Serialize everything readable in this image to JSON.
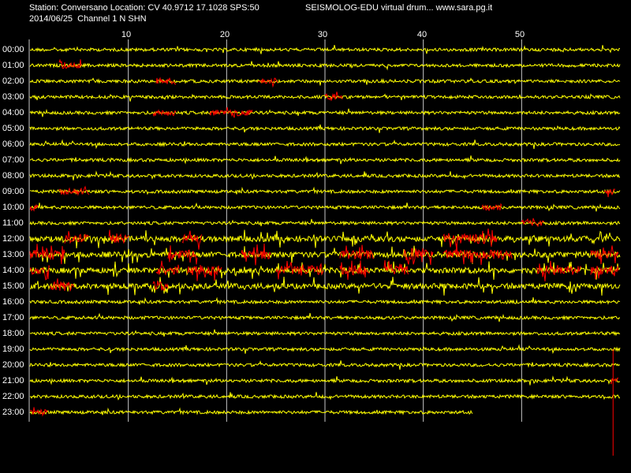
{
  "header": {
    "station_line": "Station: Conversano Location: CV 40.9712 17.1028 SPS:50",
    "brand_line": "SEISMOLOG-EDU virtual drum... www.sara.pg.it",
    "date_line": "2014/06/25  Channel 1 N SHN"
  },
  "minute_ticks": [
    "10",
    "20",
    "30",
    "40",
    "50"
  ],
  "hours": [
    "00:00",
    "01:00",
    "02:00",
    "03:00",
    "04:00",
    "05:00",
    "06:00",
    "07:00",
    "08:00",
    "09:00",
    "10:00",
    "11:00",
    "12:00",
    "13:00",
    "14:00",
    "15:00",
    "16:00",
    "17:00",
    "18:00",
    "19:00",
    "20:00",
    "21:00",
    "22:00",
    "23:00"
  ],
  "colors": {
    "background": "#000000",
    "trace": "#ffff00",
    "event": "#ff0000",
    "grid": "#c8c8c8",
    "text": "#ffffff"
  },
  "chart_data": {
    "type": "seismogram-drum",
    "x_unit": "minutes",
    "xlim": [
      0,
      60
    ],
    "last_hour_end_minute": 45,
    "events": [
      {
        "hour": 1,
        "start": 3.0,
        "end": 5.2
      },
      {
        "hour": 2,
        "start": 12.8,
        "end": 14.8
      },
      {
        "hour": 2,
        "start": 23.2,
        "end": 25.2
      },
      {
        "hour": 3,
        "start": 30.0,
        "end": 31.8
      },
      {
        "hour": 4,
        "start": 12.5,
        "end": 14.8
      },
      {
        "hour": 4,
        "start": 18.3,
        "end": 22.6
      },
      {
        "hour": 9,
        "start": 3.0,
        "end": 6.0
      },
      {
        "hour": 9,
        "start": 58.4,
        "end": 59.5
      },
      {
        "hour": 10,
        "start": 0.0,
        "end": 0.8
      },
      {
        "hour": 10,
        "start": 46.0,
        "end": 48.0
      },
      {
        "hour": 11,
        "start": 50.0,
        "end": 52.3
      },
      {
        "hour": 12,
        "start": 3.5,
        "end": 6.0
      },
      {
        "hour": 12,
        "start": 8.0,
        "end": 10.0
      },
      {
        "hour": 12,
        "start": 15.5,
        "end": 17.5
      },
      {
        "hour": 12,
        "start": 42.0,
        "end": 47.5
      },
      {
        "hour": 13,
        "start": 0.0,
        "end": 3.5
      },
      {
        "hour": 13,
        "start": 14.0,
        "end": 17.0
      },
      {
        "hour": 13,
        "start": 21.5,
        "end": 24.5
      },
      {
        "hour": 13,
        "start": 31.5,
        "end": 35.0
      },
      {
        "hour": 13,
        "start": 38.0,
        "end": 41.0
      },
      {
        "hour": 13,
        "start": 42.0,
        "end": 49.0
      },
      {
        "hour": 13,
        "start": 57.0,
        "end": 59.8
      },
      {
        "hour": 14,
        "start": 0.0,
        "end": 2.0
      },
      {
        "hour": 14,
        "start": 12.8,
        "end": 15.2
      },
      {
        "hour": 14,
        "start": 16.0,
        "end": 19.5
      },
      {
        "hour": 14,
        "start": 25.0,
        "end": 29.8
      },
      {
        "hour": 14,
        "start": 31.5,
        "end": 34.5
      },
      {
        "hour": 14,
        "start": 36.0,
        "end": 38.5
      },
      {
        "hour": 14,
        "start": 51.5,
        "end": 56.0
      },
      {
        "hour": 14,
        "start": 57.0,
        "end": 59.8
      },
      {
        "hour": 15,
        "start": 2.0,
        "end": 4.5
      },
      {
        "hour": 15,
        "start": 12.5,
        "end": 14.0
      },
      {
        "hour": 23,
        "start": 0.0,
        "end": 1.8
      },
      {
        "hour": 21,
        "start": 59.0,
        "end": 59.8
      }
    ],
    "noisy_hours": [
      12,
      13,
      14,
      15
    ]
  }
}
